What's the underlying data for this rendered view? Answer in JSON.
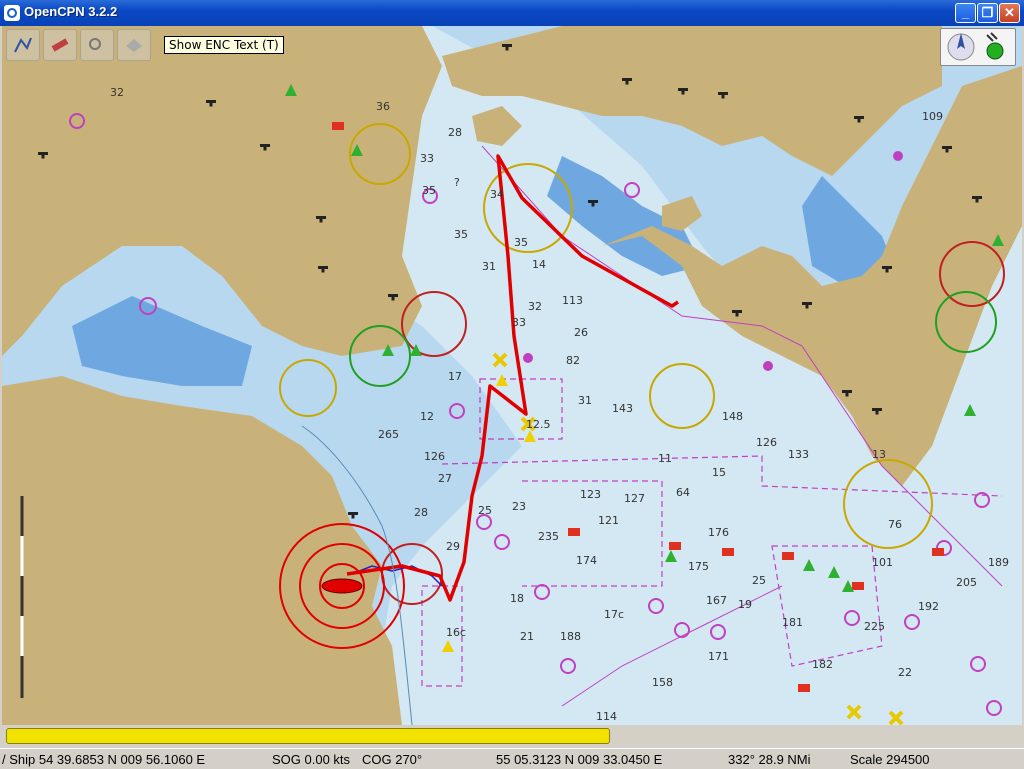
{
  "window": {
    "title": "OpenCPN 3.2.2",
    "minimize_label": "_",
    "maximize_label": "❐",
    "close_label": "✕"
  },
  "toolbar": {
    "tooltip": "Show ENC Text (T)",
    "buttons": [
      "route-icon",
      "ruler-icon",
      "zoom-icon",
      "layers-icon",
      "text-icon",
      "anchor-icon",
      "settings-icon",
      "help-icon"
    ]
  },
  "compass": {
    "icons": [
      "north-arrow-icon",
      "gps-status-icon"
    ],
    "gps_color": "#22b022"
  },
  "progress": {
    "fraction": 0.597,
    "color": "#f2e200"
  },
  "status": {
    "ship": "/ Ship 54 39.6853 N   009 56.1060 E",
    "sog": "SOG 0.00 kts",
    "cog": "COG 270°",
    "cursor": "55 05.3123 N   009 33.0450 E",
    "bearing": "332°  28.9 NMi",
    "scale": "Scale 294500"
  },
  "chart": {
    "colors": {
      "deep": "#d4e8f4",
      "shallow": "#b8d8f0",
      "medium": "#6fa8e0",
      "land": "#c9b27a",
      "route": "#e00000",
      "boundary": "#c040c0"
    },
    "depth_labels": [
      "32",
      "36",
      "33",
      "35",
      "28",
      "?",
      "35",
      "31",
      "34",
      "35",
      "14",
      "32",
      "33",
      "26",
      "113",
      "82",
      "31",
      "25",
      "23",
      "18",
      "17",
      "12",
      "126",
      "27",
      "28",
      "29",
      "235",
      "21",
      "188",
      "174",
      "143",
      "148",
      "126",
      "133",
      "11",
      "15",
      "64",
      "123",
      "127",
      "121",
      "176",
      "175",
      "167",
      "19",
      "181",
      "182",
      "158",
      "171",
      "114",
      "25",
      "13",
      "189",
      "205",
      "192",
      "22",
      "225",
      "101",
      "76",
      "17c",
      "16c",
      "12.5",
      "109",
      "265"
    ]
  }
}
